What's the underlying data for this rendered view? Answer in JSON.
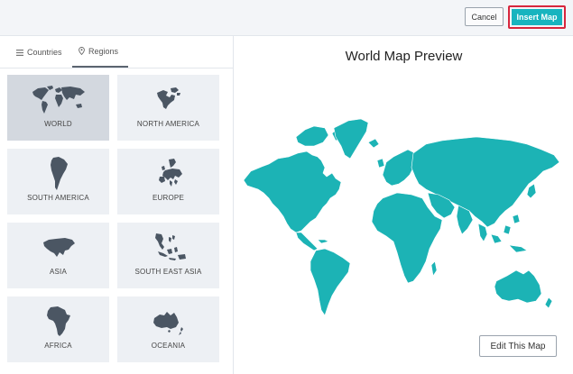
{
  "header": {
    "cancel_label": "Cancel",
    "insert_label": "Insert Map"
  },
  "tabs": [
    {
      "label": "Countries",
      "icon": "list-icon",
      "active": false
    },
    {
      "label": "Regions",
      "icon": "map-pin-icon",
      "active": true
    }
  ],
  "regions": [
    {
      "label": "WORLD",
      "selected": true
    },
    {
      "label": "NORTH AMERICA",
      "selected": false
    },
    {
      "label": "SOUTH AMERICA",
      "selected": false
    },
    {
      "label": "EUROPE",
      "selected": false
    },
    {
      "label": "ASIA",
      "selected": false
    },
    {
      "label": "SOUTH EAST ASIA",
      "selected": false
    },
    {
      "label": "AFRICA",
      "selected": false
    },
    {
      "label": "OCEANIA",
      "selected": false
    }
  ],
  "preview": {
    "title": "World Map Preview",
    "edit_label": "Edit This Map"
  },
  "colors": {
    "accent": "#18b4bf",
    "map_fill": "#1cb3b5",
    "thumb_fill": "#4b5663",
    "highlight_border": "#d7263d"
  }
}
